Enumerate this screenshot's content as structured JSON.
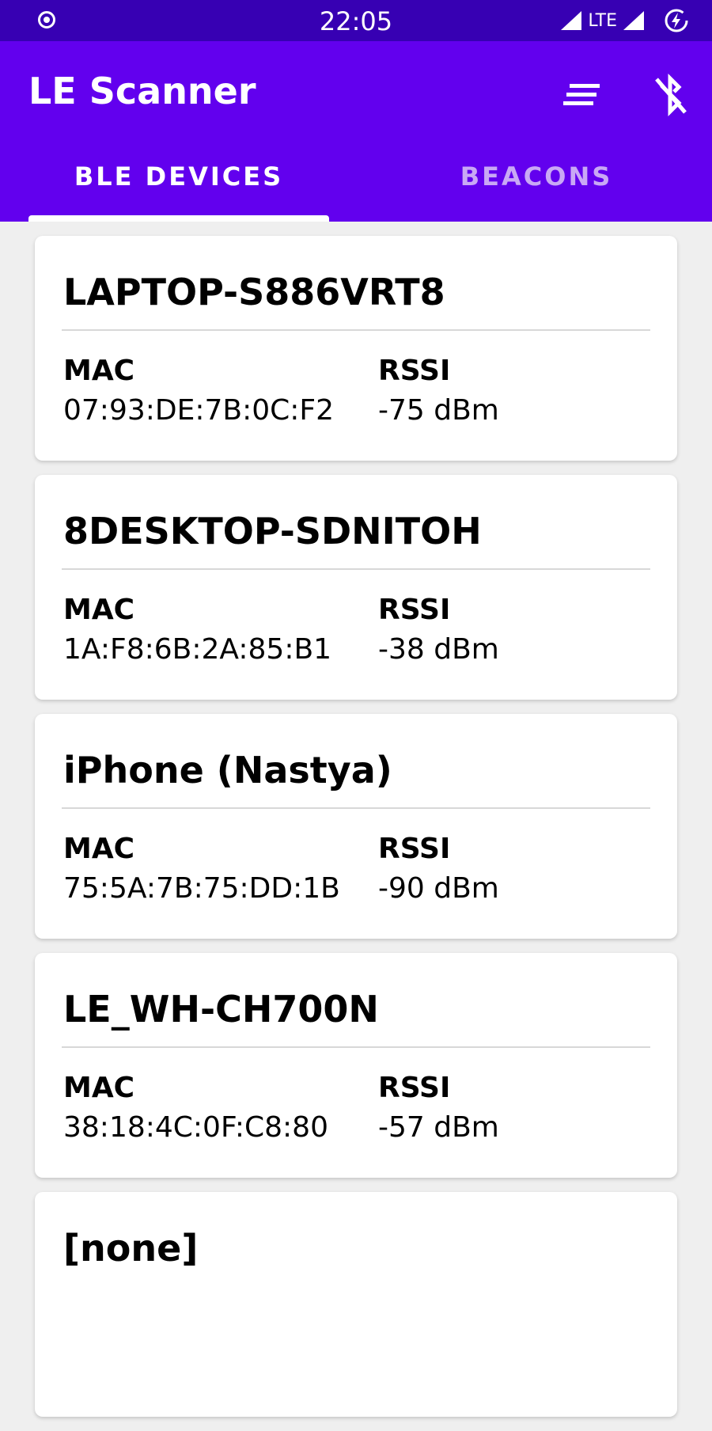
{
  "status_bar": {
    "time": "22:05",
    "network": "LTE",
    "icons": [
      "record-icon",
      "signal-icon",
      "battery-charging-icon"
    ]
  },
  "app_bar": {
    "title": "LE Scanner",
    "actions": [
      "sort-icon",
      "bluetooth-disabled-icon"
    ]
  },
  "tabs": [
    {
      "label": "BLE DEVICES",
      "selected": true
    },
    {
      "label": "BEACONS",
      "selected": false
    }
  ],
  "devices": [
    {
      "name": "LAPTOP-S886VRT8",
      "mac_label": "MAC",
      "mac": "07:93:DE:7B:0C:F2",
      "rssi_label": "RSSI",
      "rssi": "-75 dBm"
    },
    {
      "name": "8DESKTOP-SDNITOH",
      "mac_label": "MAC",
      "mac": "1A:F8:6B:2A:85:B1",
      "rssi_label": "RSSI",
      "rssi": "-38 dBm"
    },
    {
      "name": "iPhone (Nastya)",
      "mac_label": "MAC",
      "mac": "75:5A:7B:75:DD:1B",
      "rssi_label": "RSSI",
      "rssi": "-90 dBm"
    },
    {
      "name": "LE_WH-CH700N",
      "mac_label": "MAC",
      "mac": "38:18:4C:0F:C8:80",
      "rssi_label": "RSSI",
      "rssi": "-57 dBm"
    },
    {
      "name": "[none]"
    }
  ],
  "colors": {
    "status_bar": "#3700b3",
    "app_bar": "#6200ee",
    "tab_inactive": "#c9a8f5",
    "background": "#efefef"
  }
}
